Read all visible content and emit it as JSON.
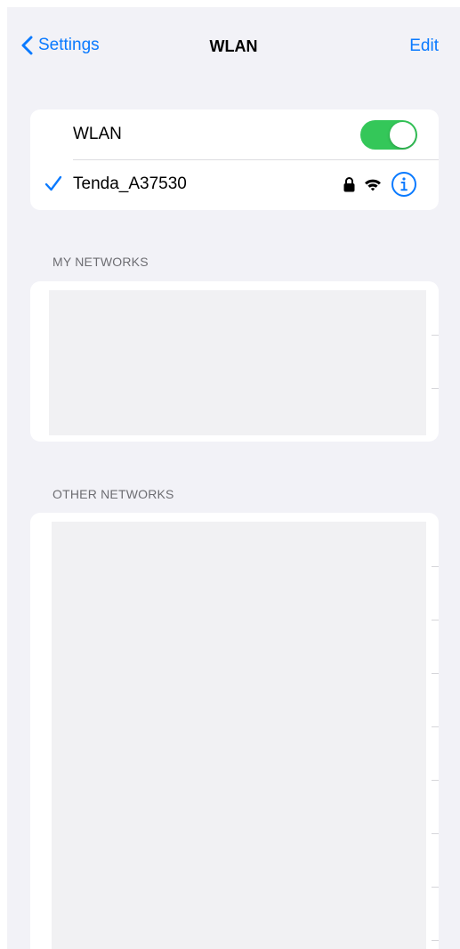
{
  "nav": {
    "back_label": "Settings",
    "title": "WLAN",
    "edit_label": "Edit"
  },
  "wlan": {
    "label": "WLAN",
    "enabled": true
  },
  "connected_network": {
    "name": "Tenda_A37530",
    "secured": true,
    "icons": [
      "checkmark-icon",
      "lock-icon",
      "wifi-icon",
      "info-icon"
    ]
  },
  "sections": {
    "my_networks_header": "MY NETWORKS",
    "other_networks_header": "OTHER NETWORKS"
  },
  "colors": {
    "accent": "#0a7aff",
    "toggle_on": "#34c759",
    "background": "#f2f2f7",
    "card": "#ffffff",
    "section_header": "#6d6d72"
  }
}
